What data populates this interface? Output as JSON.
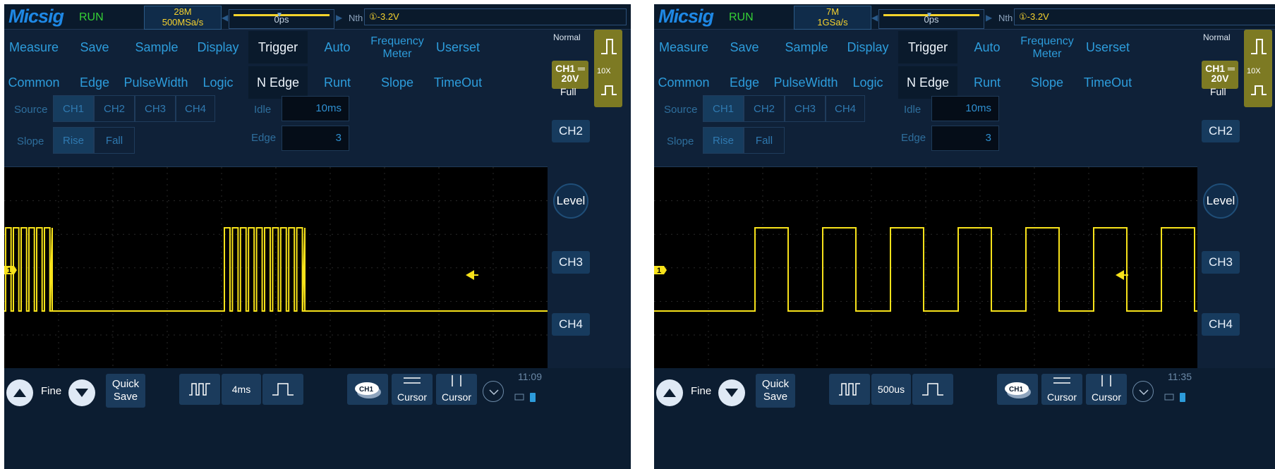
{
  "panels": [
    {
      "logo": "Micsig",
      "run_status": "RUN",
      "memory_depth": "28M",
      "sample_rate": "500MSa/s",
      "h_position": "0ps",
      "nth_label": "Nth",
      "trigger_channel_icon": "①",
      "trigger_level": "-3.2V",
      "menu": [
        "Measure",
        "Save",
        "Sample",
        "Display",
        "Trigger",
        "Auto",
        "Frequency Meter",
        "Userset"
      ],
      "submenu": [
        "Common",
        "Edge",
        "PulseWidth",
        "Logic",
        "N Edge",
        "Runt",
        "Slope",
        "TimeOut"
      ],
      "source_label": "Source",
      "sources": [
        "CH1",
        "CH2",
        "CH3",
        "CH4"
      ],
      "slope_label": "Slope",
      "slopes": [
        "Rise",
        "Fall"
      ],
      "idle_label": "Idle",
      "idle_value": "10ms",
      "edge_label": "Edge",
      "edge_value": "3",
      "trigger_mode": "Normal",
      "ch1_label": "CH1",
      "ch1_scale": "20V",
      "probe": "10X",
      "bandwidth": "Full",
      "side_buttons": [
        "CH2",
        "Level",
        "CH3",
        "CH4"
      ],
      "fine_label": "Fine",
      "quick_save": [
        "Quick",
        "Save"
      ],
      "timebase": "4ms",
      "cursor_labels": [
        "Cursor",
        "Cursor"
      ],
      "ch1_badge": "CH1",
      "clock": "11:09",
      "marker": "1"
    },
    {
      "logo": "Micsig",
      "run_status": "RUN",
      "memory_depth": "7M",
      "sample_rate": "1GSa/s",
      "h_position": "0ps",
      "nth_label": "Nth",
      "trigger_channel_icon": "①",
      "trigger_level": "-3.2V",
      "menu": [
        "Measure",
        "Save",
        "Sample",
        "Display",
        "Trigger",
        "Auto",
        "Frequency Meter",
        "Userset"
      ],
      "submenu": [
        "Common",
        "Edge",
        "PulseWidth",
        "Logic",
        "N Edge",
        "Runt",
        "Slope",
        "TimeOut"
      ],
      "source_label": "Source",
      "sources": [
        "CH1",
        "CH2",
        "CH3",
        "CH4"
      ],
      "slope_label": "Slope",
      "slopes": [
        "Rise",
        "Fall"
      ],
      "idle_label": "Idle",
      "idle_value": "10ms",
      "edge_label": "Edge",
      "edge_value": "3",
      "trigger_mode": "Normal",
      "ch1_label": "CH1",
      "ch1_scale": "20V",
      "probe": "10X",
      "bandwidth": "Full",
      "side_buttons": [
        "CH2",
        "Level",
        "CH3",
        "CH4"
      ],
      "fine_label": "Fine",
      "quick_save": [
        "Quick",
        "Save"
      ],
      "timebase": "500us",
      "cursor_labels": [
        "Cursor",
        "Cursor"
      ],
      "ch1_badge": "CH1",
      "clock": "11:35",
      "marker": "1"
    }
  ],
  "colors": {
    "accent_blue": "#2d9cdb",
    "trace_yellow": "#f7e21a",
    "run_green": "#35d036",
    "trigger_olive": "#7d7a23"
  }
}
